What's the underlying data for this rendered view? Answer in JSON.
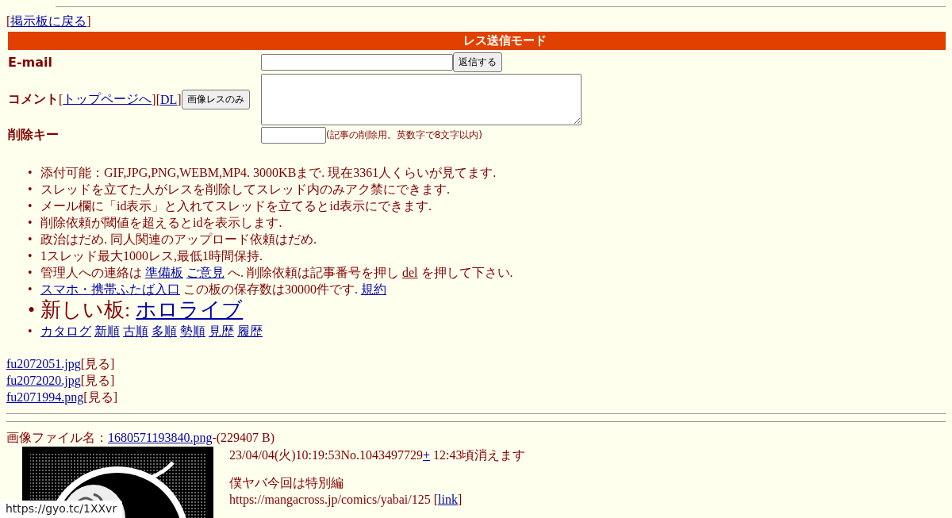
{
  "back_link": {
    "open": "[",
    "label": "掲示板に戻る",
    "close": "]"
  },
  "form": {
    "title": "レス送信モード",
    "email_label": "E-mail",
    "submit_button": "返信する",
    "comment_label": "コメント",
    "top_link": {
      "open": "[",
      "label": "トップページへ",
      "close": "]"
    },
    "dl_link": {
      "open": "[",
      "label": "DL",
      "close": "]"
    },
    "image_only_button": "画像レスのみ",
    "delkey_label": "削除キー",
    "delkey_note": "(記事の削除用。英数字で8文字以内)"
  },
  "notices": [
    {
      "marker": "•",
      "large": false,
      "segments": [
        {
          "kind": "text",
          "text": "添付可能：GIF,JPG,PNG,WEBM,MP4. 3000KBまで. 現在3361人くらいが見てます."
        }
      ]
    },
    {
      "marker": "•",
      "large": false,
      "segments": [
        {
          "kind": "text",
          "text": "スレッドを立てた人がレスを削除してスレッド内のみアク禁にできます."
        }
      ]
    },
    {
      "marker": "•",
      "large": false,
      "segments": [
        {
          "kind": "text",
          "text": "メール欄に「id表示」と入れてスレッドを立てるとid表示にできます."
        }
      ]
    },
    {
      "marker": "•",
      "large": false,
      "segments": [
        {
          "kind": "text",
          "text": "削除依頼が閾値を超えるとidを表示します."
        }
      ]
    },
    {
      "marker": "•",
      "large": false,
      "segments": [
        {
          "kind": "text",
          "text": "政治はだめ. 同人関連のアップロード依頼はだめ."
        }
      ]
    },
    {
      "marker": "•",
      "large": false,
      "segments": [
        {
          "kind": "text",
          "text": "1スレッド最大1000レス,最低1時間保持."
        }
      ]
    },
    {
      "marker": "•",
      "large": false,
      "segments": [
        {
          "kind": "text",
          "text": "管理人への連絡は"
        },
        {
          "kind": "link",
          "text": "準備板"
        },
        {
          "kind": "link",
          "text": "ご意見"
        },
        {
          "kind": "text",
          "text": "へ. 削除依頼は記事番号を押し"
        },
        {
          "kind": "underline",
          "text": "del"
        },
        {
          "kind": "text",
          "text": "を押して下さい."
        }
      ]
    },
    {
      "marker": "•",
      "large": false,
      "segments": [
        {
          "kind": "link",
          "text": "スマホ・携帯ふたば入口"
        },
        {
          "kind": "text",
          "text": "この板の保存数は30000件です."
        },
        {
          "kind": "link",
          "text": "規約"
        }
      ]
    },
    {
      "marker": "•",
      "large": true,
      "segments": [
        {
          "kind": "text",
          "text": "新しい板:"
        },
        {
          "kind": "link",
          "text": "ホロライブ"
        }
      ]
    },
    {
      "marker": "•",
      "large": false,
      "segments": [
        {
          "kind": "link",
          "text": "カタログ"
        },
        {
          "kind": "link",
          "text": "新順"
        },
        {
          "kind": "link",
          "text": "古順"
        },
        {
          "kind": "link",
          "text": "多順"
        },
        {
          "kind": "link",
          "text": "勢順"
        },
        {
          "kind": "link",
          "text": "見歴"
        },
        {
          "kind": "link",
          "text": "履歴"
        }
      ]
    }
  ],
  "files": [
    {
      "name": "fu2072051.jpg",
      "view": "[見る]"
    },
    {
      "name": "fu2072020.jpg",
      "view": "[見る]"
    },
    {
      "name": "fu2071994.png",
      "view": "[見る]"
    }
  ],
  "post": {
    "file_label": "画像ファイル名：",
    "file_name": "1680571193840.png",
    "file_size": "-(229407 B)",
    "header": "23/04/04(火)10:19:53No.1043497729",
    "plus_link": "+",
    "expires": "12:43頃消えます",
    "body": "僕ヤバ今回は特別編",
    "url": "https://mangacross.jp/comics/yabai/125",
    "link_label": {
      "open": "[",
      "label": "link",
      "close": "]"
    }
  },
  "status_bar": "https://gyo.tc/1XXvr"
}
